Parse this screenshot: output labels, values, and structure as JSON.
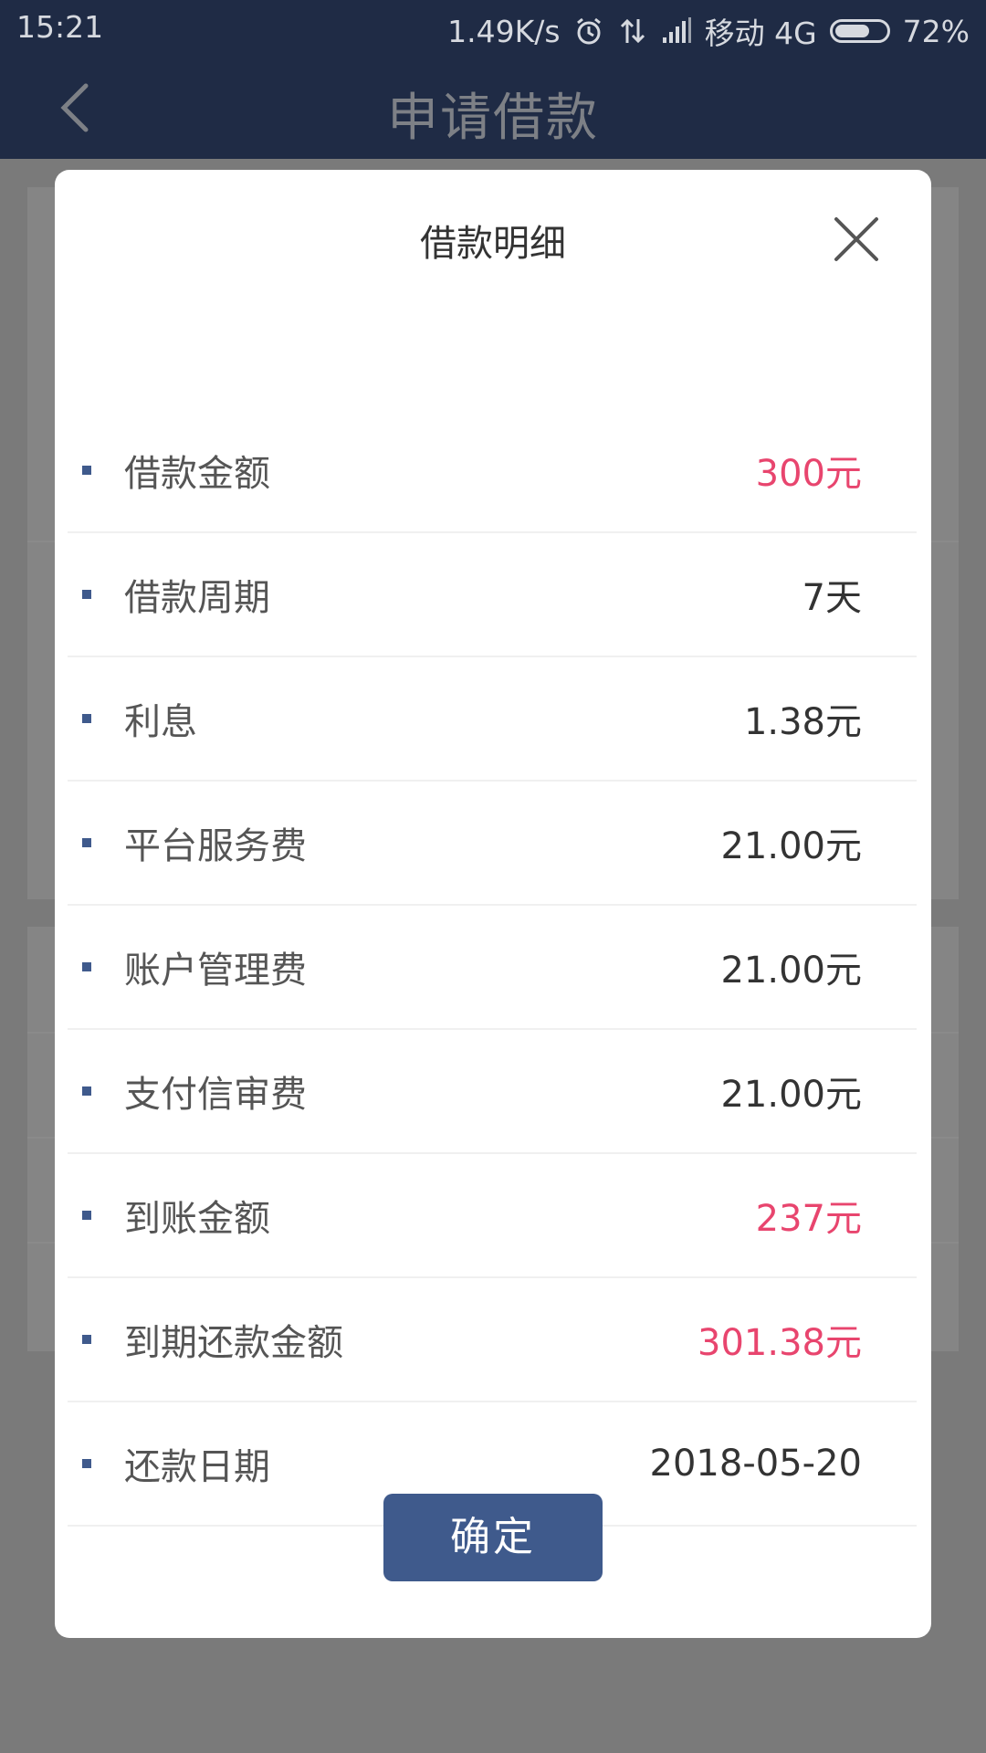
{
  "status_bar": {
    "time": "15:21",
    "network_speed": "1.49K/s",
    "carrier": "移动 4G",
    "battery_percent": "72%",
    "battery_level": 0.72
  },
  "app_bar": {
    "title": "申请借款",
    "back_icon": "chevron-left-icon"
  },
  "modal": {
    "title": "借款明细",
    "close_icon": "close-icon",
    "rows": [
      {
        "label": "借款金额",
        "value": "300元",
        "accent": true
      },
      {
        "label": "借款周期",
        "value": "7天",
        "accent": false
      },
      {
        "label": "利息",
        "value": "1.38元",
        "accent": false
      },
      {
        "label": "平台服务费",
        "value": "21.00元",
        "accent": false
      },
      {
        "label": "账户管理费",
        "value": "21.00元",
        "accent": false
      },
      {
        "label": "支付信审费",
        "value": "21.00元",
        "accent": false
      },
      {
        "label": "到账金额",
        "value": "237元",
        "accent": true
      },
      {
        "label": "到期还款金额",
        "value": "301.38元",
        "accent": true
      },
      {
        "label": "还款日期",
        "value": "2018-05-20",
        "accent": false
      }
    ],
    "confirm_label": "确定"
  },
  "colors": {
    "header_bg": "#1f2b45",
    "accent": "#e8456e",
    "primary": "#3f5a8c",
    "overlay": "#7a7a7a"
  }
}
